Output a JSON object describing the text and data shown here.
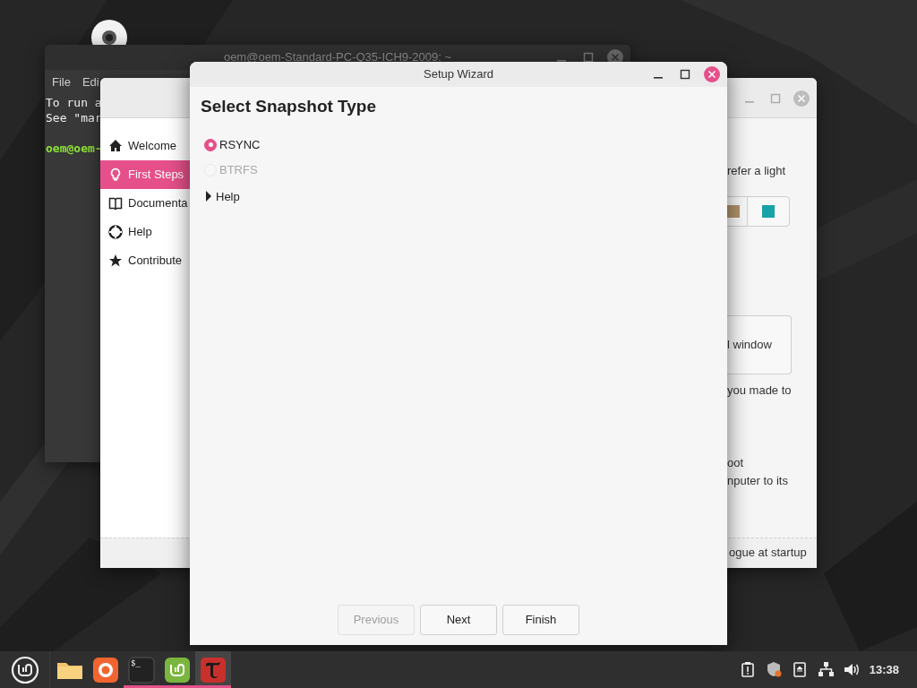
{
  "terminal": {
    "title": "oem@oem-Standard-PC-Q35-ICH9-2009: ~",
    "menu": [
      "File",
      "Edi"
    ],
    "lines": [
      {
        "text": "To run a",
        "kind": "output"
      },
      {
        "text": "See \"mar",
        "kind": "output"
      },
      {
        "text": "oem@oem-",
        "kind": "prompt"
      }
    ]
  },
  "welcome": {
    "sidebar": [
      {
        "label": "Welcome",
        "selected": false
      },
      {
        "label": "First Steps",
        "selected": true
      },
      {
        "label": "Documenta",
        "selected": false
      },
      {
        "label": "Help",
        "selected": false
      },
      {
        "label": "Contribute",
        "selected": false
      }
    ],
    "content": [
      {
        "kind": "text",
        "text": "refer a light"
      },
      {
        "kind": "swatches"
      },
      {
        "kind": "button",
        "text": "l window"
      },
      {
        "kind": "text",
        "text": "you made to"
      },
      {
        "kind": "text",
        "text": "oot"
      },
      {
        "kind": "text",
        "text": "nputer to its"
      }
    ],
    "footer": "ogue at startup"
  },
  "wizard": {
    "title": "Setup Wizard",
    "heading": "Select Snapshot Type",
    "options": [
      {
        "label": "RSYNC",
        "selected": true,
        "disabled": false
      },
      {
        "label": "BTRFS",
        "selected": false,
        "disabled": true
      }
    ],
    "help": {
      "label": "Help",
      "expanded": false
    },
    "buttons": [
      {
        "label": "Previous",
        "disabled": true
      },
      {
        "label": "Next",
        "disabled": false
      },
      {
        "label": "Finish",
        "disabled": false
      }
    ]
  },
  "taskbar": {
    "apps": [
      {
        "running": false,
        "active": false
      },
      {
        "running": false,
        "active": false
      },
      {
        "glyph": "$_",
        "running": true,
        "active": false
      },
      {
        "running": true,
        "active": false
      },
      {
        "running": true,
        "active": true
      }
    ],
    "clock": "13:38"
  }
}
